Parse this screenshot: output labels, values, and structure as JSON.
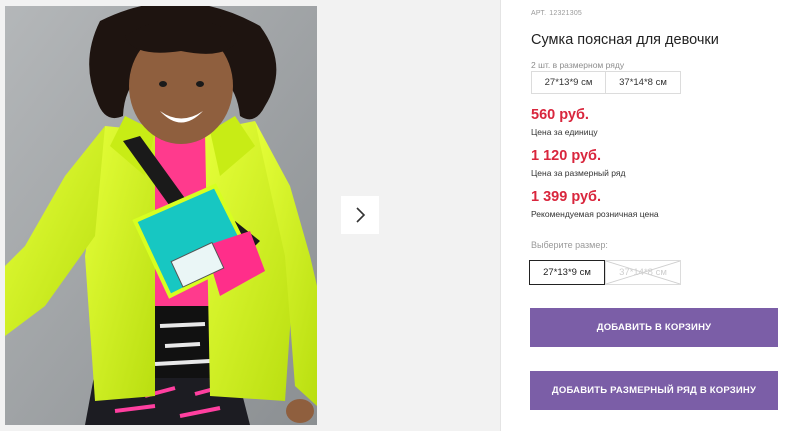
{
  "gallery": {
    "next_icon": "chevron-right-icon"
  },
  "product": {
    "article_label": "АРТ.",
    "article_number": "12321305",
    "title": "Сумка поясная для девочки",
    "pack_label": "2 шт. в размерном ряду",
    "pack_sizes": [
      "27*13*9 см",
      "37*14*8 см"
    ],
    "prices": [
      {
        "value": "560 руб.",
        "caption": "Цена за единицу"
      },
      {
        "value": "1 120 руб.",
        "caption": "Цена за размерный ряд"
      },
      {
        "value": "1 399 руб.",
        "caption": "Рекомендуемая розничная цена"
      }
    ],
    "size_label": "Выберите размер:",
    "size_options": [
      {
        "label": "27*13*9 см",
        "selected": true,
        "available": true
      },
      {
        "label": "37*14*8 см",
        "selected": false,
        "available": false
      }
    ],
    "add_to_cart_label": "ДОБАВИТЬ В КОРЗИНУ",
    "add_pack_label": "ДОБАВИТЬ РАЗМЕРНЫЙ РЯД В КОРЗИНУ"
  },
  "colors": {
    "accent": "#7b5ea7",
    "price": "#d9263d",
    "jacket": "#d4f21c",
    "bag_teal": "#17c7c2",
    "shirt_pink": "#ff2e8a"
  }
}
